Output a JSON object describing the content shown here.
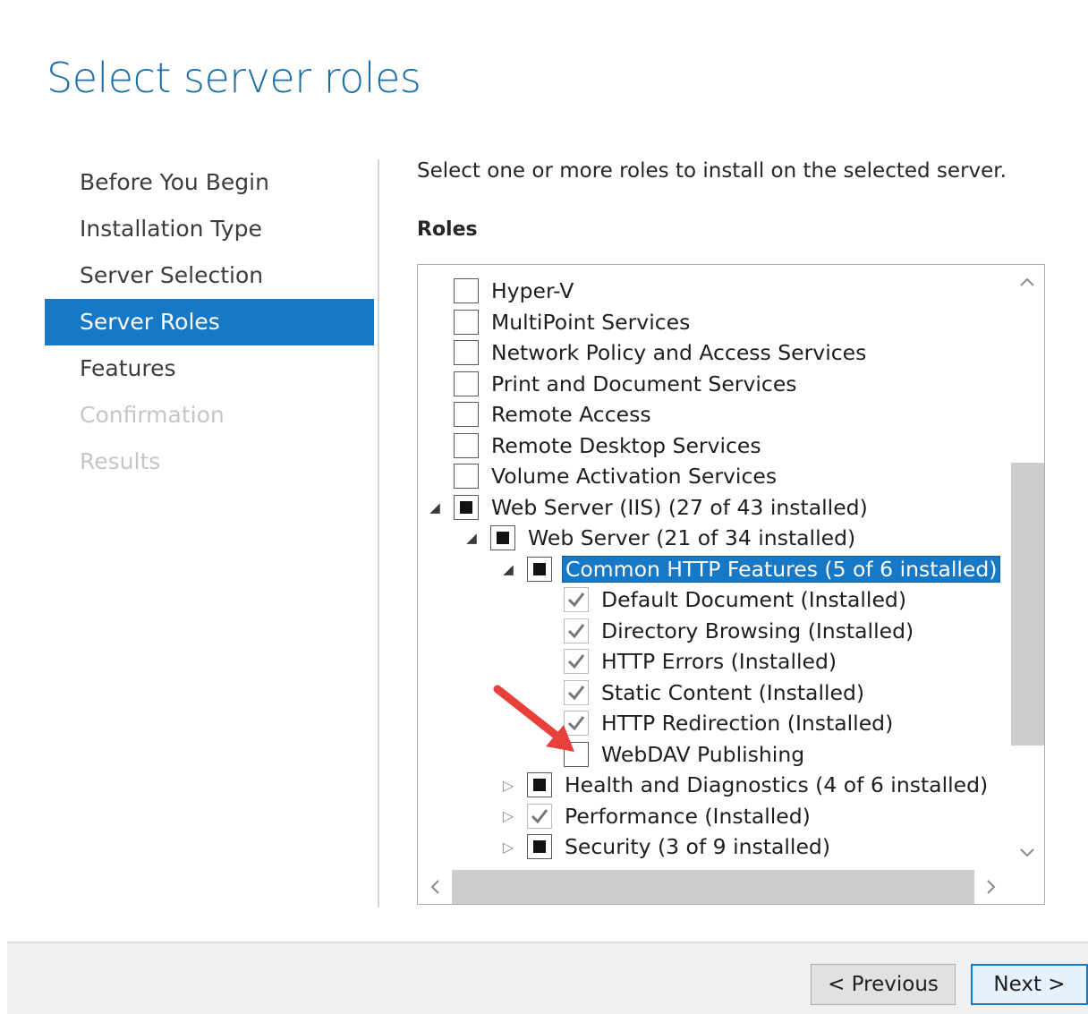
{
  "page": {
    "title": "Select server roles"
  },
  "nav": {
    "items": [
      {
        "label": "Before You Begin",
        "state": "normal"
      },
      {
        "label": "Installation Type",
        "state": "normal"
      },
      {
        "label": "Server Selection",
        "state": "normal"
      },
      {
        "label": "Server Roles",
        "state": "active"
      },
      {
        "label": "Features",
        "state": "normal"
      },
      {
        "label": "Confirmation",
        "state": "disabled"
      },
      {
        "label": "Results",
        "state": "disabled"
      }
    ]
  },
  "main": {
    "instruction": "Select one or more roles to install on the selected server.",
    "roles_label": "Roles",
    "roles": [
      {
        "label": "Hyper-V",
        "level": 0,
        "expander": "none",
        "state": "unchecked"
      },
      {
        "label": "MultiPoint Services",
        "level": 0,
        "expander": "none",
        "state": "unchecked"
      },
      {
        "label": "Network Policy and Access Services",
        "level": 0,
        "expander": "none",
        "state": "unchecked"
      },
      {
        "label": "Print and Document Services",
        "level": 0,
        "expander": "none",
        "state": "unchecked"
      },
      {
        "label": "Remote Access",
        "level": 0,
        "expander": "none",
        "state": "unchecked"
      },
      {
        "label": "Remote Desktop Services",
        "level": 0,
        "expander": "none",
        "state": "unchecked"
      },
      {
        "label": "Volume Activation Services",
        "level": 0,
        "expander": "none",
        "state": "unchecked"
      },
      {
        "label": "Web Server (IIS) (27 of 43 installed)",
        "level": 0,
        "expander": "expanded",
        "state": "mixed"
      },
      {
        "label": "Web Server (21 of 34 installed)",
        "level": 1,
        "expander": "expanded",
        "state": "mixed"
      },
      {
        "label": "Common HTTP Features (5 of 6 installed)",
        "level": 2,
        "expander": "expanded",
        "state": "mixed",
        "selected": true
      },
      {
        "label": "Default Document (Installed)",
        "level": 3,
        "expander": "none",
        "state": "checked-disabled"
      },
      {
        "label": "Directory Browsing (Installed)",
        "level": 3,
        "expander": "none",
        "state": "checked-disabled"
      },
      {
        "label": "HTTP Errors (Installed)",
        "level": 3,
        "expander": "none",
        "state": "checked-disabled"
      },
      {
        "label": "Static Content (Installed)",
        "level": 3,
        "expander": "none",
        "state": "checked-disabled"
      },
      {
        "label": "HTTP Redirection (Installed)",
        "level": 3,
        "expander": "none",
        "state": "checked-disabled"
      },
      {
        "label": "WebDAV Publishing",
        "level": 3,
        "expander": "none",
        "state": "unchecked"
      },
      {
        "label": "Health and Diagnostics (4 of 6 installed)",
        "level": 2,
        "expander": "collapsed",
        "state": "mixed"
      },
      {
        "label": "Performance (Installed)",
        "level": 2,
        "expander": "collapsed",
        "state": "checked-disabled"
      },
      {
        "label": "Security (3 of 9 installed)",
        "level": 2,
        "expander": "collapsed",
        "state": "mixed"
      }
    ]
  },
  "icons": {
    "expanded": "expanded-triangle-icon",
    "collapsed": "collapsed-triangle-icon",
    "scroll_up": "chevron-up-icon",
    "scroll_down": "chevron-down-icon",
    "scroll_left": "chevron-left-icon",
    "scroll_right": "chevron-right-icon",
    "annotation": "red-arrow-icon"
  },
  "colors": {
    "accent": "#1778c5",
    "title": "#1b6ea8",
    "annotation_arrow": "#e8413c"
  },
  "footer": {
    "previous_label": "< Previous",
    "next_label": "Next >"
  }
}
